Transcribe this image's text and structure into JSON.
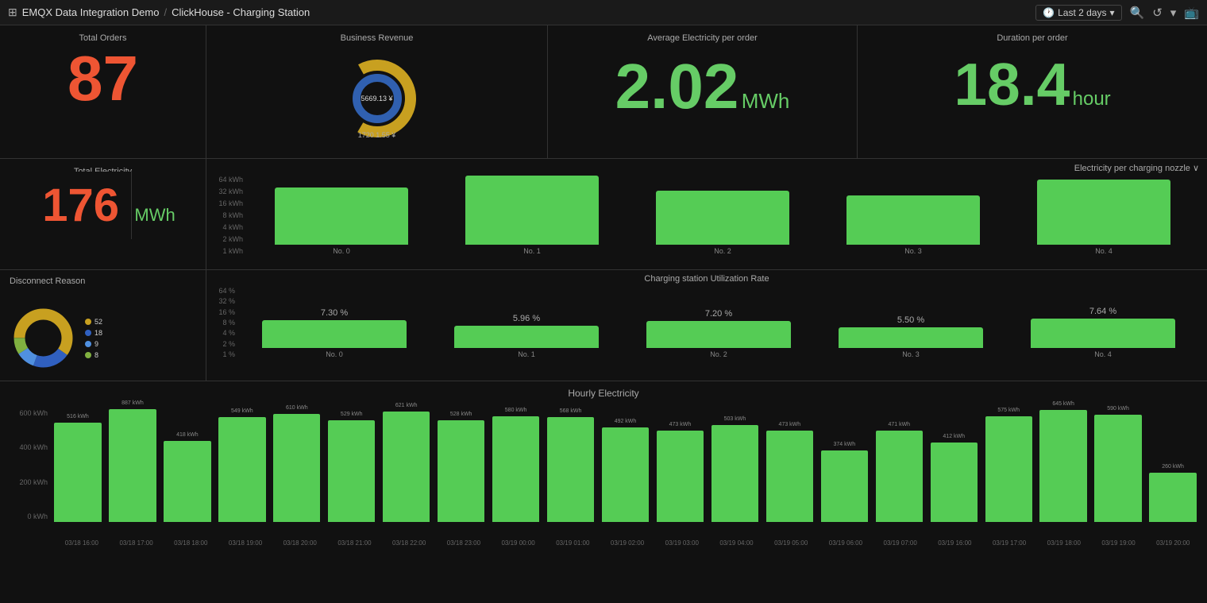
{
  "header": {
    "app_name": "EMQX Data Integration Demo",
    "separator": "/",
    "page_title": "ClickHouse - Charging Station",
    "time_label": "Last 2 days",
    "icons": [
      "clock",
      "search",
      "refresh",
      "chevron-down",
      "tv"
    ]
  },
  "row1": {
    "total_orders": {
      "label": "Total Orders",
      "value": "87",
      "color": "red"
    },
    "business_revenue": {
      "label": "Business Revenue",
      "outer_value": "5669.13 ¥",
      "inner_value": "1720 1.55 ¥"
    },
    "avg_electricity": {
      "label": "Average Electricity per order",
      "value": "2.02",
      "unit": "MWh"
    },
    "duration": {
      "label": "Duration per order",
      "value": "18.4",
      "unit": "hour"
    }
  },
  "row2": {
    "total_electricity": {
      "label": "Total Electricity",
      "value": "176",
      "unit": "MWh"
    },
    "chart": {
      "title": "Electricity per charging nozzle",
      "y_labels": [
        "64 kWh",
        "32 kWh",
        "16 kWh",
        "8 kWh",
        "4 kWh",
        "2 kWh",
        "1 kWh"
      ],
      "bars": [
        {
          "label": "No. 0",
          "height_pct": 72
        },
        {
          "label": "No. 1",
          "height_pct": 88
        },
        {
          "label": "No. 2",
          "height_pct": 68
        },
        {
          "label": "No. 3",
          "height_pct": 62
        },
        {
          "label": "No. 4",
          "height_pct": 82
        }
      ]
    }
  },
  "row3": {
    "disconnect": {
      "label": "Disconnect Reason",
      "segments": [
        {
          "label": "52",
          "color": "#c8a020",
          "pct": 52
        },
        {
          "label": "18",
          "color": "#3060c0",
          "pct": 18
        },
        {
          "label": "9",
          "color": "#5090e0",
          "pct": 9
        },
        {
          "label": "8",
          "color": "#80b040",
          "pct": 8
        }
      ]
    },
    "utilization": {
      "title": "Charging station Utilization Rate",
      "y_labels": [
        "64 %",
        "32 %",
        "16 %",
        "8 %",
        "4 %",
        "2 %",
        "1 %"
      ],
      "bars": [
        {
          "label": "No. 0",
          "pct": "7.30 %",
          "height_pct": 35
        },
        {
          "label": "No. 1",
          "pct": "5.96 %",
          "height_pct": 28
        },
        {
          "label": "No. 2",
          "pct": "7.20 %",
          "height_pct": 34
        },
        {
          "label": "No. 3",
          "pct": "5.50 %",
          "height_pct": 26
        },
        {
          "label": "No. 4",
          "pct": "7.64 %",
          "height_pct": 37
        }
      ]
    }
  },
  "row4": {
    "title": "Hourly Electricity",
    "y_labels": [
      "600 kWh",
      "400 kWh",
      "200 kWh",
      "0 kWh"
    ],
    "bars": [
      {
        "time": "03/18 16:00",
        "value": "516 kWh",
        "height_pct": 86
      },
      {
        "time": "03/18 17:00",
        "value": "887 kWh",
        "height_pct": 98
      },
      {
        "time": "03/18 18:00",
        "value": "418 kWh",
        "height_pct": 70
      },
      {
        "time": "03/18 19:00",
        "value": "549 kWh",
        "height_pct": 91
      },
      {
        "time": "03/18 20:00",
        "value": "610 kWh",
        "height_pct": 94
      },
      {
        "time": "03/18 21:00",
        "value": "529 kWh",
        "height_pct": 88
      },
      {
        "time": "03/18 22:00",
        "value": "621 kWh",
        "height_pct": 96
      },
      {
        "time": "03/18 23:00",
        "value": "528 kWh",
        "height_pct": 88
      },
      {
        "time": "03/19 00:00",
        "value": "580 kWh",
        "height_pct": 92
      },
      {
        "time": "03/19 01:00",
        "value": "568 kWh",
        "height_pct": 91
      },
      {
        "time": "03/19 02:00",
        "value": "492 kWh",
        "height_pct": 82
      },
      {
        "time": "03/19 03:00",
        "value": "473 kWh",
        "height_pct": 79
      },
      {
        "time": "03/19 04:00",
        "value": "503 kWh",
        "height_pct": 84
      },
      {
        "time": "03/19 05:00",
        "value": "473 kWh",
        "height_pct": 79
      },
      {
        "time": "03/19 06:00",
        "value": "374 kWh",
        "height_pct": 62
      },
      {
        "time": "03/19 07:00",
        "value": "471 kWh",
        "height_pct": 79
      },
      {
        "time": "03/19 16:00",
        "value": "412 kWh",
        "height_pct": 69
      },
      {
        "time": "03/19 17:00",
        "value": "575 kWh",
        "height_pct": 92
      },
      {
        "time": "03/19 18:00",
        "value": "645 kWh",
        "height_pct": 97
      },
      {
        "time": "03/19 19:00",
        "value": "590 kWh",
        "height_pct": 93
      },
      {
        "time": "03/19 20:00",
        "value": "260 kWh",
        "height_pct": 43
      }
    ]
  }
}
